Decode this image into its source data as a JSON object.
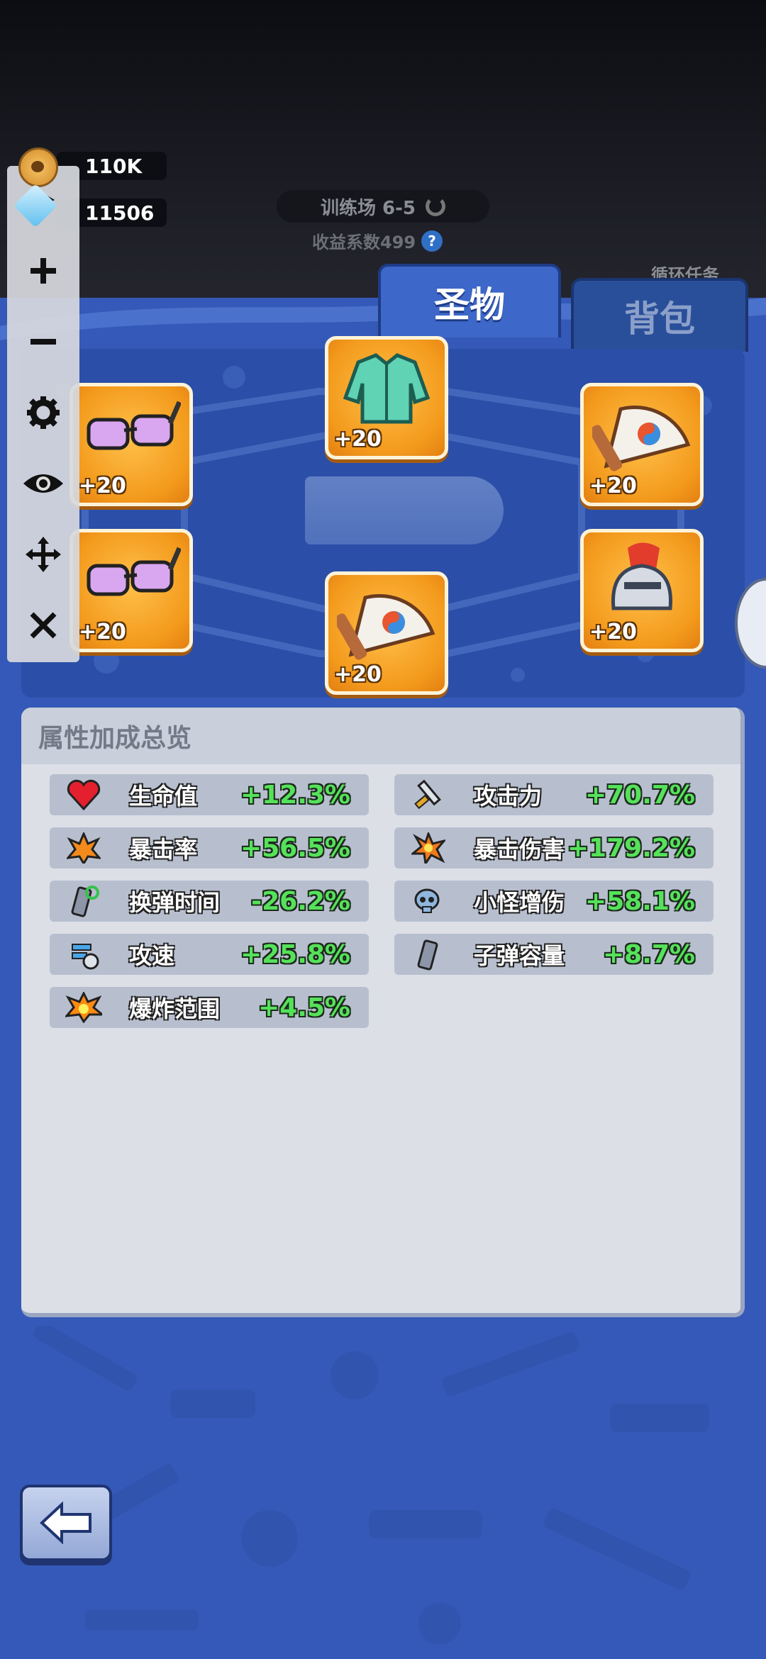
{
  "currency": {
    "coins": "110K",
    "gems": "11506"
  },
  "stage": {
    "name": "训练场 6-5",
    "income": "收益系数499",
    "help": "?",
    "side_task": "循环任务"
  },
  "tabs": {
    "relics": "圣物",
    "backpack": "背包"
  },
  "relics": [
    {
      "name": "goggles-relic",
      "level": "+20"
    },
    {
      "name": "jacket-relic",
      "level": "+20"
    },
    {
      "name": "fan-relic",
      "level": "+20"
    },
    {
      "name": "goggles-relic",
      "level": "+20"
    },
    {
      "name": "fan-relic",
      "level": "+20"
    },
    {
      "name": "helmet-relic",
      "level": "+20"
    }
  ],
  "attributes": {
    "title": "属性加成总览",
    "left": [
      {
        "label": "生命值",
        "value": "+12.3%",
        "icon": "heart-icon"
      },
      {
        "label": "暴击率",
        "value": "+56.5%",
        "icon": "burst-icon"
      },
      {
        "label": "换弹时间",
        "value": "-26.2%",
        "icon": "reload-icon"
      },
      {
        "label": "攻速",
        "value": "+25.8%",
        "icon": "speed-icon"
      },
      {
        "label": "爆炸范围",
        "value": "+4.5%",
        "icon": "explosion-icon"
      }
    ],
    "right": [
      {
        "label": "攻击力",
        "value": "+70.7%",
        "icon": "sword-icon"
      },
      {
        "label": "暴击伤害",
        "value": "+179.2%",
        "icon": "star-burst-icon"
      },
      {
        "label": "小怪增伤",
        "value": "+58.1%",
        "icon": "skull-icon"
      },
      {
        "label": "子弹容量",
        "value": "+8.7%",
        "icon": "magazine-icon"
      }
    ]
  },
  "colors": {
    "accent_blue": "#3559b8",
    "value_green": "#55e25a",
    "slot_orange": "#f39a1c"
  }
}
